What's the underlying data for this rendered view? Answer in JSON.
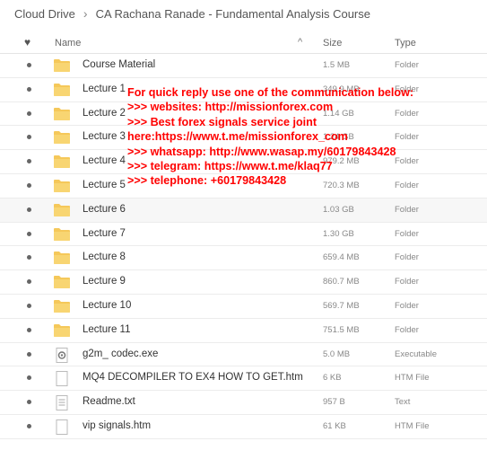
{
  "breadcrumb": {
    "root": "Cloud Drive",
    "separator": "›",
    "current": "CA Rachana Ranade - Fundamental Analysis Course"
  },
  "header": {
    "favorite_icon": "♥",
    "name": "Name",
    "sort_icon": "^",
    "size": "Size",
    "type": "Type"
  },
  "files": [
    {
      "name": "Course Material",
      "size": "1.5 MB",
      "type": "Folder",
      "icon": "folder-icon"
    },
    {
      "name": "Lecture 1",
      "size": "349.9 MB",
      "type": "Folder",
      "icon": "folder-icon"
    },
    {
      "name": "Lecture 2",
      "size": "1.14 GB",
      "type": "Folder",
      "icon": "folder-icon"
    },
    {
      "name": "Lecture 3",
      "size": "1.24 GB",
      "type": "Folder",
      "icon": "folder-icon"
    },
    {
      "name": "Lecture 4",
      "size": "979.2 MB",
      "type": "Folder",
      "icon": "folder-icon"
    },
    {
      "name": "Lecture 5",
      "size": "720.3 MB",
      "type": "Folder",
      "icon": "folder-icon"
    },
    {
      "name": "Lecture 6",
      "size": "1.03 GB",
      "type": "Folder",
      "icon": "folder-icon"
    },
    {
      "name": "Lecture 7",
      "size": "1.30 GB",
      "type": "Folder",
      "icon": "folder-icon"
    },
    {
      "name": "Lecture 8",
      "size": "659.4 MB",
      "type": "Folder",
      "icon": "folder-icon"
    },
    {
      "name": "Lecture 9",
      "size": "860.7 MB",
      "type": "Folder",
      "icon": "folder-icon"
    },
    {
      "name": "Lecture 10",
      "size": "569.7 MB",
      "type": "Folder",
      "icon": "folder-icon"
    },
    {
      "name": "Lecture 11",
      "size": "751.5 MB",
      "type": "Folder",
      "icon": "folder-icon"
    },
    {
      "name": "g2m_ codec.exe",
      "size": "5.0 MB",
      "type": "Executable",
      "icon": "executable-icon"
    },
    {
      "name": "MQ4 DECOMPILER TO EX4 HOW TO GET.htm",
      "size": "6 KB",
      "type": "HTM File",
      "icon": "file-icon"
    },
    {
      "name": "Readme.txt",
      "size": "957 B",
      "type": "Text",
      "icon": "text-file-icon"
    },
    {
      "name": "vip signals.htm",
      "size": "61 KB",
      "type": "HTM File",
      "icon": "file-icon"
    }
  ],
  "overlay": [
    "For quick reply use one of the communication below:",
    ">>> websites: http://missionforex.com",
    ">>> Best forex signals service joint",
    "here:https://www.t.me/missionforex_com",
    ">>> whatsapp: http://www.wasap.my/60179843428",
    ">>> telegram: https://www.t.me/klaq77",
    ">>> telephone: +60179843428"
  ],
  "colors": {
    "folder": "#f5c85a",
    "overlay_text": "#ff0000",
    "highlight_row": "#f7f7f7"
  }
}
